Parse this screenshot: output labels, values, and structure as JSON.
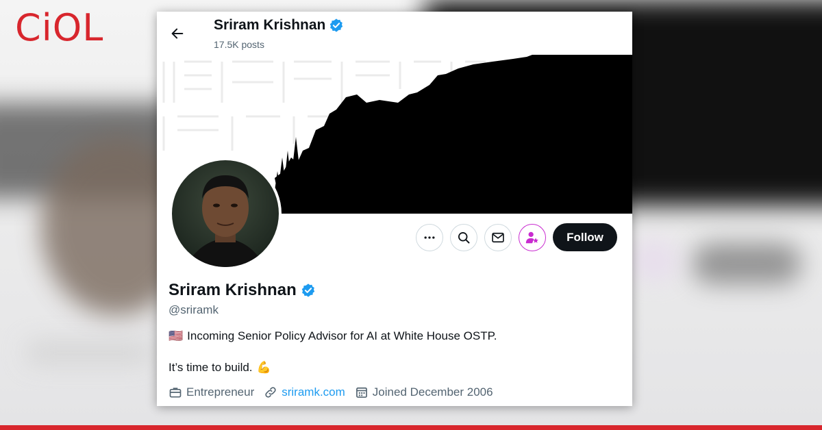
{
  "site_logo": "CiOL",
  "colors": {
    "brand_red": "#d8262d",
    "verified_blue": "#1d9bf0",
    "follow_bg": "#0f1419",
    "subscribe_accent": "#c92bd0"
  },
  "header": {
    "back_icon": "arrow-left-icon",
    "name": "Sriram Krishnan",
    "posts": "17.5K posts"
  },
  "actions": {
    "more_icon": "more-horizontal-icon",
    "search_icon": "search-icon",
    "message_icon": "envelope-icon",
    "subscribe_icon": "person-star-icon",
    "follow_label": "Follow"
  },
  "profile": {
    "name": "Sriram Krishnan",
    "handle": "@sriramk",
    "bio_flag": "🇺🇸",
    "bio_line1": "Incoming Senior Policy Advisor for AI at White House OSTP.",
    "bio_line2": "It’s time to build.",
    "bio_emoji": "💪",
    "profession": "Entrepreneur",
    "website": "sriramk.com",
    "joined": "Joined December 2006"
  }
}
